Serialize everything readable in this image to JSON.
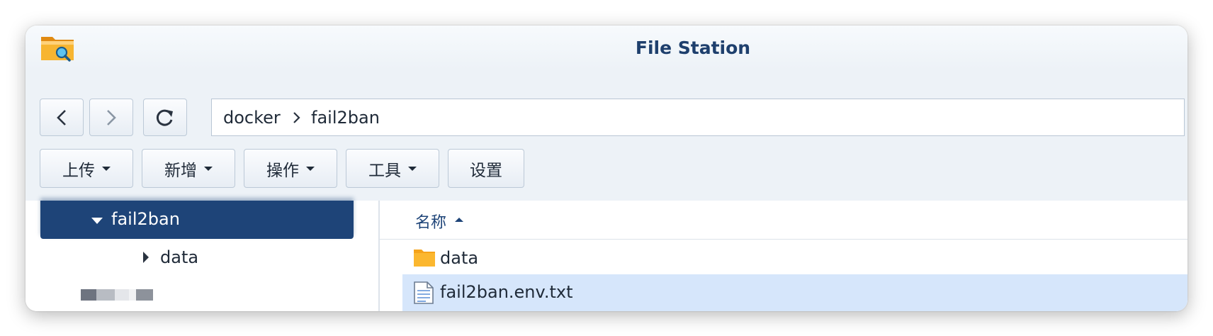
{
  "app": {
    "title": "File Station",
    "icon": "file-station-folder-icon"
  },
  "navigation": {
    "back_icon": "chevron-left-icon",
    "forward_icon": "chevron-right-icon",
    "refresh_icon": "refresh-icon"
  },
  "path": {
    "segments": [
      "docker",
      "fail2ban"
    ],
    "separator_icon": "chevron-right-icon",
    "favorite_icon": "star-icon"
  },
  "toolbar": {
    "buttons": [
      {
        "label": "上传",
        "has_dropdown": true
      },
      {
        "label": "新增",
        "has_dropdown": true
      },
      {
        "label": "操作",
        "has_dropdown": true
      },
      {
        "label": "工具",
        "has_dropdown": true
      },
      {
        "label": "设置",
        "has_dropdown": false
      }
    ]
  },
  "tree": {
    "selected": {
      "label": "fail2ban",
      "expanded": true
    },
    "children": [
      {
        "label": "data",
        "expanded": false
      }
    ],
    "blurred_items": 2
  },
  "file_list": {
    "column_header": "名称",
    "sort": "ascending",
    "rows": [
      {
        "name": "data",
        "type": "folder",
        "icon": "folder-icon",
        "selected": false
      },
      {
        "name": "fail2ban.env.txt",
        "type": "text",
        "icon": "text-file-icon",
        "selected": true
      }
    ]
  },
  "colors": {
    "accent": "#1e4478",
    "selection": "#d6e6fb",
    "title": "#1e3f6d",
    "folder": "#f5a31a"
  }
}
